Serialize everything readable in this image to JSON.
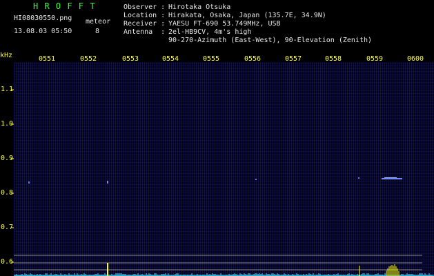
{
  "header": {
    "program": "H R O F F T",
    "filename": "HI08030550.png",
    "datetime": "13.08.03 05:50",
    "meteor_label": "meteor",
    "meteor_count": "8",
    "observer_label": "Observer :",
    "observer": "Hirotaka Otsuka",
    "location_label": "Location :",
    "location": "Hirakata, Osaka, Japan (135.7E, 34.9N)",
    "receiver_label": "Receiver :",
    "receiver": "YAESU FT-690 53.749MHz, USB",
    "antenna_label": "Antenna  :",
    "antenna_line1": "2el-HB9CV, 4m's high",
    "antenna_line2": "90-270-Azimuth (East-West), 90-Elevation (Zenith)"
  },
  "axis": {
    "unit": "kHz",
    "y_ticks": [
      "1.1",
      "1.0",
      "0.9",
      "0.8",
      "0.7",
      "0.6"
    ],
    "x_ticks": [
      "0551",
      "0552",
      "0553",
      "0554",
      "0555",
      "0556",
      "0557",
      "0558",
      "0559",
      "0600"
    ]
  },
  "colors": {
    "header_text": "#e8e8e8",
    "tick_text": "#ffff3c",
    "program_title": "#3cff3c",
    "meteor_echo": "#5c7cff",
    "signal_baseline": "#40e0ff",
    "signal_peak": "#ffff00",
    "reference_lines": "#8c8c8c"
  }
}
